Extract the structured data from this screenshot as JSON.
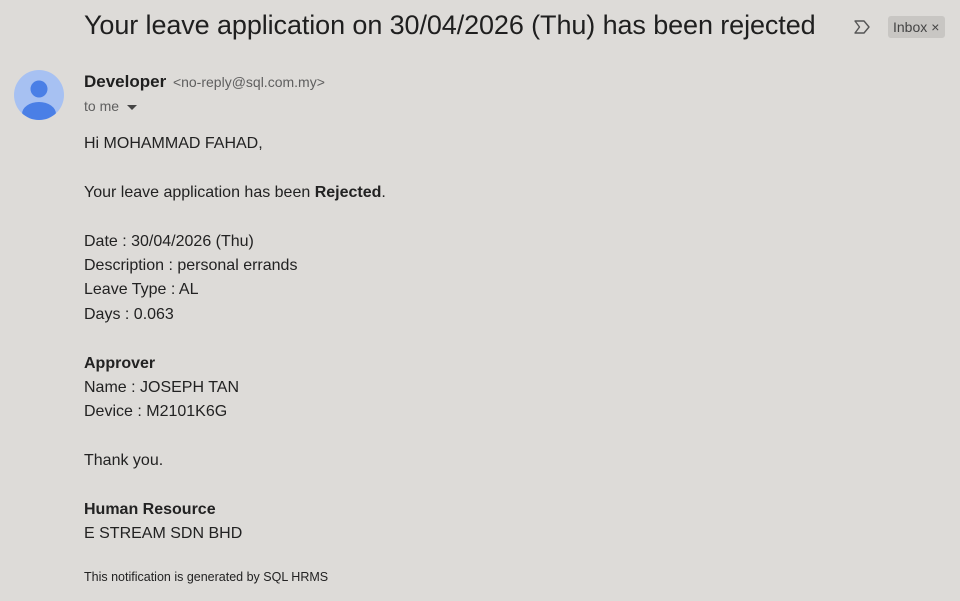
{
  "email": {
    "subject": "Your leave application on 30/04/2026 (Thu) has been rejected",
    "label": "Inbox",
    "label_close": "×",
    "sender": {
      "name": "Developer",
      "email": "<no-reply@sql.com.my>"
    },
    "recipient": "to me",
    "body": {
      "greeting": "Hi MOHAMMAD FAHAD,",
      "status_prefix": "Your leave application has been ",
      "status_value": "Rejected",
      "status_suffix": ".",
      "date": "Date : 30/04/2026 (Thu)",
      "description": "Description : personal errands",
      "leave_type": "Leave Type : AL",
      "days": "Days : 0.063",
      "approver_heading": "Approver",
      "approver_name": "Name : JOSEPH TAN",
      "approver_device": "Device : M2101K6G",
      "thanks": "Thank you.",
      "signature_title": "Human Resource",
      "signature_company": "E STREAM SDN BHD"
    },
    "footer": "This notification is generated by SQL HRMS"
  },
  "icons": {
    "important": "importance-marker-icon",
    "avatar": "person-avatar-icon",
    "caret": "caret-down-icon"
  },
  "colors": {
    "background": "#dddbd8",
    "avatar": "#a7c1f2",
    "avatar_figure": "#4a7fe6"
  }
}
